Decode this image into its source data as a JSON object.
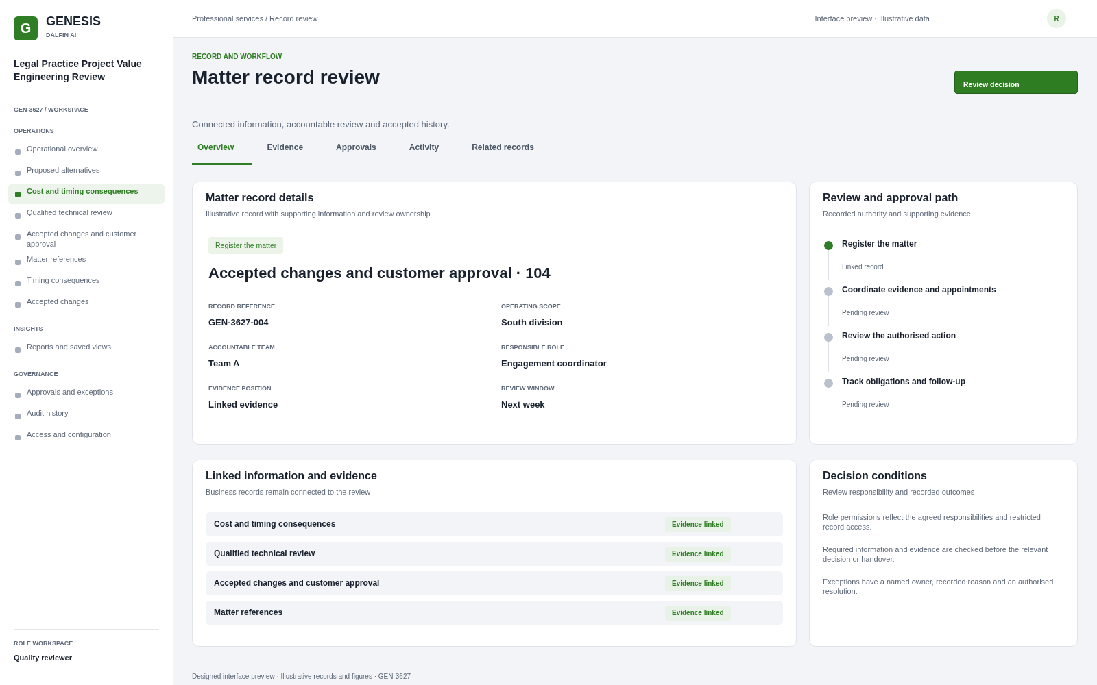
{
  "brand": {
    "logo": "G",
    "name": "GENESIS",
    "tagline": "DALFIN AI"
  },
  "sidebar": {
    "project_title": "Legal Practice Project Value Engineering Review",
    "workspace_path": "GEN-3627 / WORKSPACE",
    "sections": [
      {
        "heading": "OPERATIONS",
        "items": [
          {
            "label": "Operational overview",
            "selected": false
          },
          {
            "label": "Proposed alternatives",
            "selected": false
          },
          {
            "label": "Cost and timing consequences",
            "selected": true
          },
          {
            "label": "Qualified technical review",
            "selected": false
          },
          {
            "label": "Accepted changes and customer approval",
            "selected": false
          },
          {
            "label": "Matter references",
            "selected": false
          },
          {
            "label": "Timing consequences",
            "selected": false
          },
          {
            "label": "Accepted changes",
            "selected": false
          }
        ]
      },
      {
        "heading": "INSIGHTS",
        "items": [
          {
            "label": "Reports and saved views",
            "selected": false
          }
        ]
      },
      {
        "heading": "GOVERNANCE",
        "items": [
          {
            "label": "Approvals and exceptions",
            "selected": false
          },
          {
            "label": "Audit history",
            "selected": false
          },
          {
            "label": "Access and configuration",
            "selected": false
          }
        ]
      }
    ],
    "role": {
      "label": "ROLE WORKSPACE",
      "value": "Quality reviewer"
    }
  },
  "top_bar": {
    "breadcrumb": "Professional services / Record review",
    "note": "Interface preview · Illustrative data",
    "avatar": "R"
  },
  "header": {
    "eyebrow": "RECORD AND WORKFLOW",
    "title": "Matter record review",
    "action": "Review decision",
    "description": "Connected information, accountable review and accepted history."
  },
  "tabs": [
    {
      "label": "Overview",
      "selected": true
    },
    {
      "label": "Evidence",
      "selected": false
    },
    {
      "label": "Approvals",
      "selected": false
    },
    {
      "label": "Activity",
      "selected": false
    },
    {
      "label": "Related records",
      "selected": false
    }
  ],
  "record_details": {
    "title": "Matter record details",
    "subtitle": "Illustrative record with supporting information and review ownership",
    "stage": "Register the matter",
    "heading": "Accepted changes and customer approval · 104",
    "fields": [
      {
        "label": "RECORD REFERENCE",
        "value": "GEN-3627-004"
      },
      {
        "label": "OPERATING SCOPE",
        "value": "South division"
      },
      {
        "label": "ACCOUNTABLE TEAM",
        "value": "Team A"
      },
      {
        "label": "RESPONSIBLE ROLE",
        "value": "Engagement coordinator"
      },
      {
        "label": "EVIDENCE POSITION",
        "value": "Linked evidence"
      },
      {
        "label": "REVIEW WINDOW",
        "value": "Next week"
      }
    ]
  },
  "approval_path": {
    "title": "Review and approval path",
    "subtitle": "Recorded authority and supporting evidence",
    "steps": [
      {
        "title": "Register the matter",
        "status": "Linked record",
        "completed": true
      },
      {
        "title": "Coordinate evidence and appointments",
        "status": "Pending review",
        "completed": false
      },
      {
        "title": "Review the authorised action",
        "status": "Pending review",
        "completed": false
      },
      {
        "title": "Track obligations and follow-up",
        "status": "Pending review",
        "completed": false
      }
    ]
  },
  "linked_evidence": {
    "title": "Linked information and evidence",
    "subtitle": "Business records remain connected to the review",
    "rows": [
      {
        "label": "Cost and timing consequences",
        "status": "Evidence linked"
      },
      {
        "label": "Qualified technical review",
        "status": "Evidence linked"
      },
      {
        "label": "Accepted changes and customer approval",
        "status": "Evidence linked"
      },
      {
        "label": "Matter references",
        "status": "Evidence linked"
      }
    ]
  },
  "decision_conditions": {
    "title": "Decision conditions",
    "subtitle": "Review responsibility and recorded outcomes",
    "conditions": [
      "Role permissions reflect the agreed responsibilities and restricted record access.",
      "Required information and evidence are checked before the relevant decision or handover.",
      "Exceptions have a named owner, recorded reason and an authorised resolution."
    ]
  },
  "footer": "Designed interface preview · Illustrative records and figures · GEN-3627"
}
